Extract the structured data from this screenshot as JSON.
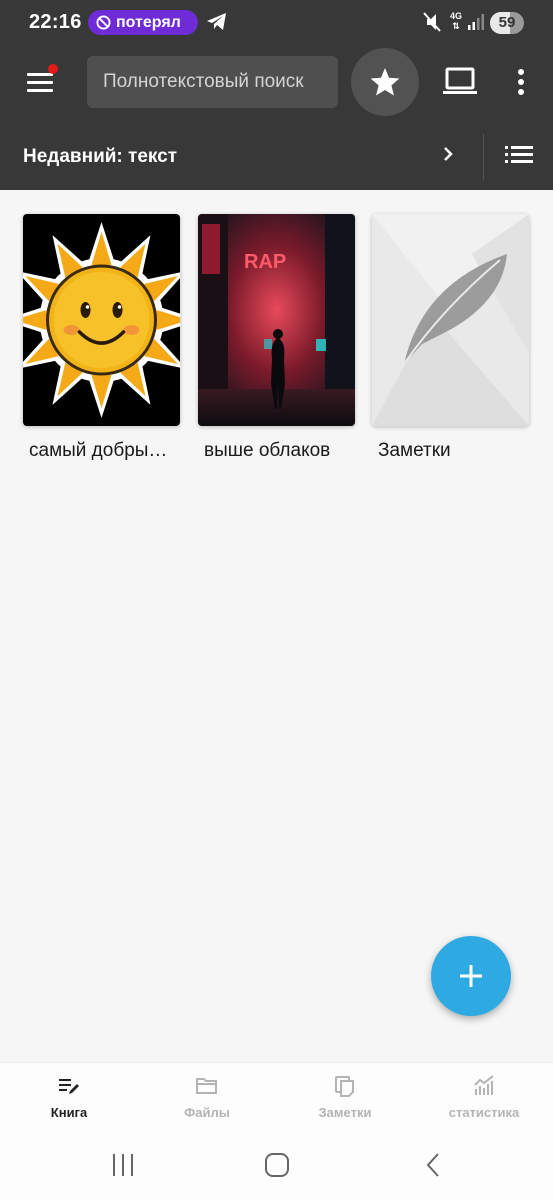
{
  "status_bar": {
    "time": "22:16",
    "notification_text": "потерял",
    "network_label": "4G",
    "battery_level": "59",
    "pill_color": "#6f2bd6"
  },
  "toolbar": {
    "search_placeholder": "Полнотекстовый поиск",
    "icons": [
      "menu-icon",
      "star-icon",
      "laptop-icon",
      "more-vertical-icon"
    ]
  },
  "recent": {
    "title": "Недавний: текст"
  },
  "books": [
    {
      "title": "самый добры…",
      "cover": "sun-sticker"
    },
    {
      "title": "выше облаков",
      "cover": "neon-street-rap",
      "cover_text": "RAP"
    },
    {
      "title": "Заметки",
      "cover": "feather-placeholder"
    }
  ],
  "bottom_nav": {
    "items": [
      {
        "label": "Книга",
        "icon": "book-edit-icon",
        "active": true
      },
      {
        "label": "Файлы",
        "icon": "folder-icon",
        "active": false
      },
      {
        "label": "Заметки",
        "icon": "notes-icon",
        "active": false
      },
      {
        "label": "статистика",
        "icon": "chart-icon",
        "active": false
      }
    ]
  },
  "colors": {
    "header_bg": "#383838",
    "accent": "#2ea9e2",
    "notification_dot": "#e31a1a"
  }
}
